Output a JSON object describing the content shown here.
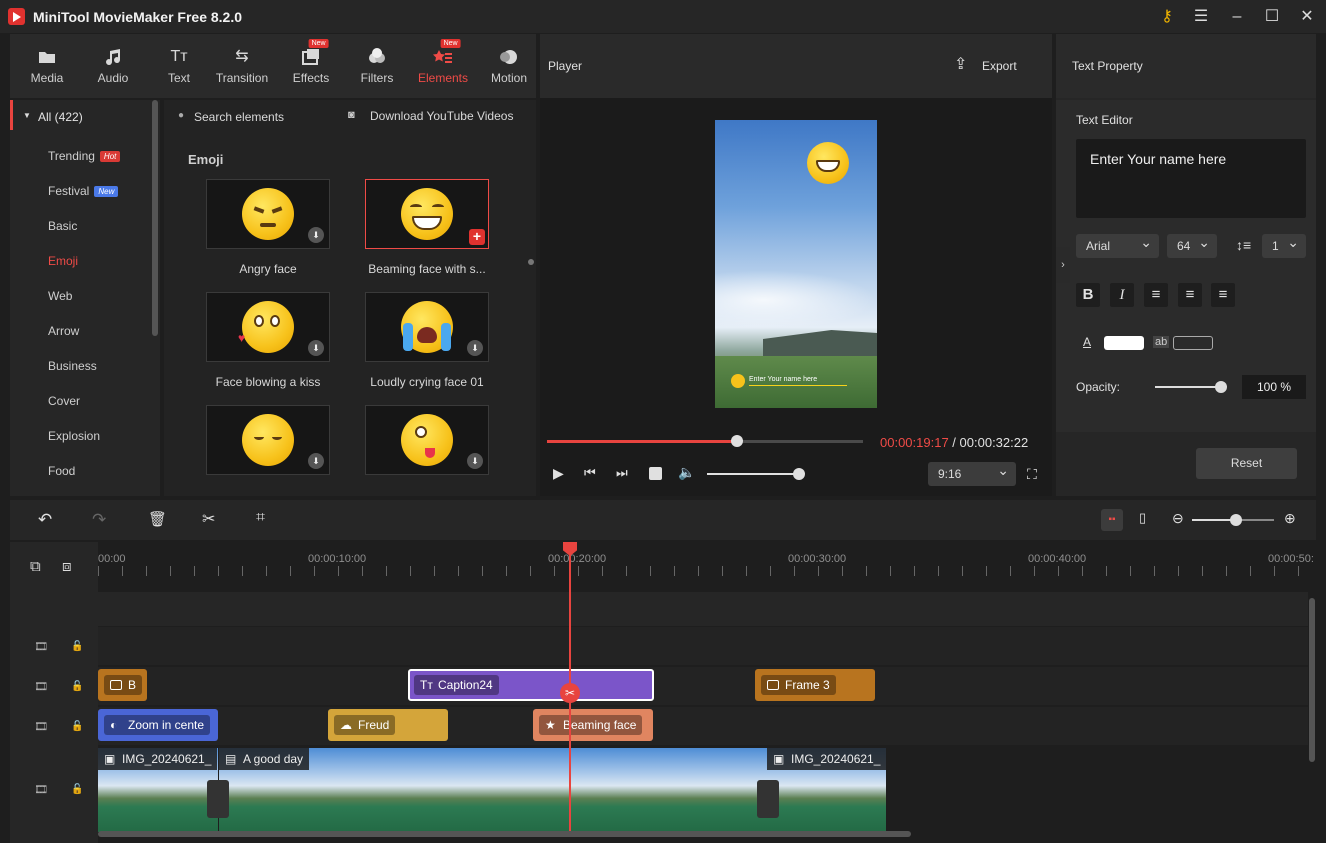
{
  "app": {
    "title": "MiniTool MovieMaker Free 8.2.0"
  },
  "tabs": [
    {
      "label": "Media",
      "icon": "folder-icon"
    },
    {
      "label": "Audio",
      "icon": "music-note-icon"
    },
    {
      "label": "Text",
      "icon": "text-icon"
    },
    {
      "label": "Transition",
      "icon": "transition-arrows-icon"
    },
    {
      "label": "Effects",
      "icon": "effects-icon",
      "badge": "New"
    },
    {
      "label": "Filters",
      "icon": "filters-icon"
    },
    {
      "label": "Elements",
      "icon": "elements-icon",
      "badge": "New",
      "active": true
    },
    {
      "label": "Motion",
      "icon": "motion-icon"
    }
  ],
  "sidebar": {
    "all_label": "All (422)",
    "items": [
      {
        "label": "Trending",
        "badge": "Hot"
      },
      {
        "label": "Festival",
        "badge": "New"
      },
      {
        "label": "Basic"
      },
      {
        "label": "Emoji",
        "active": true
      },
      {
        "label": "Web"
      },
      {
        "label": "Arrow"
      },
      {
        "label": "Business"
      },
      {
        "label": "Cover"
      },
      {
        "label": "Explosion"
      },
      {
        "label": "Food"
      }
    ]
  },
  "elements": {
    "search_placeholder": "Search elements",
    "download_link": "Download YouTube Videos",
    "section": "Emoji",
    "items": [
      {
        "name": "Angry face"
      },
      {
        "name": "Beaming face with s..."
      },
      {
        "name": "Face blowing a kiss"
      },
      {
        "name": "Loudly crying face 01"
      }
    ]
  },
  "player": {
    "label": "Player",
    "export_label": "Export",
    "caption_text": "Enter Your name here",
    "time_current": "00:00:19:17",
    "time_sep": " / ",
    "time_total": "00:00:32:22",
    "progress": 0.6,
    "volume": 0.98,
    "aspect": "9:16"
  },
  "props": {
    "title": "Text Property",
    "editor_label": "Text Editor",
    "editor_text": "Enter Your name here",
    "font": "Arial",
    "size": "64",
    "line_spacing": "1",
    "opacity_label": "Opacity:",
    "opacity_value": "100 %",
    "opacity": 1.0,
    "bg_label": "ab",
    "reset_label": "Reset"
  },
  "timeline": {
    "ticks": [
      "00:00",
      "00:00:10:00",
      "00:00:20:00",
      "00:00:30:00",
      "00:00:40:00",
      "00:00:50:"
    ],
    "clips_row1": [
      {
        "label": "B",
        "color": "#b8741f"
      },
      {
        "label": "Caption24",
        "color": "#7b55c9"
      },
      {
        "label": "Frame 3",
        "color": "#b8741f"
      }
    ],
    "clips_row2": [
      {
        "label": "Zoom in cente",
        "color": "#4a66d6"
      },
      {
        "label": "Freud",
        "color": "#d4a53a"
      },
      {
        "label": "Beaming face",
        "color": "#e08560"
      }
    ],
    "video_clips": [
      {
        "label": "IMG_20240621_"
      },
      {
        "label": "A good day"
      },
      {
        "label": "IMG_20240621_"
      }
    ]
  },
  "colors": {
    "accent": "#e8443f",
    "panel": "#2a2a2a"
  }
}
